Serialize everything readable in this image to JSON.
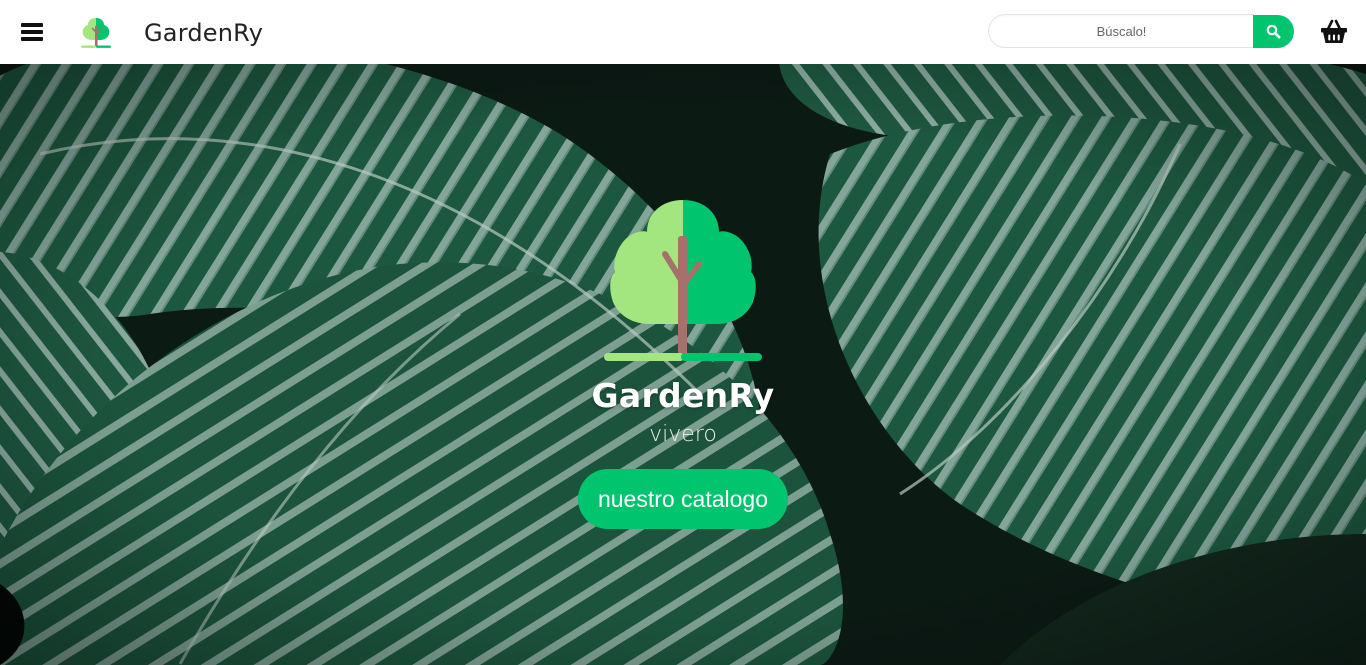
{
  "header": {
    "brand": "GardenRy",
    "search_placeholder": "Búscalo!"
  },
  "hero": {
    "title": "GardenRy",
    "subtitle": "vivero",
    "cta_label": "nuestro catalogo"
  },
  "icons": {
    "menu": "hamburger-menu-icon",
    "logo": "tree-logo-icon",
    "search": "magnifier-icon",
    "cart": "shopping-basket-icon"
  },
  "colors": {
    "accent": "#00c46e",
    "tree_light": "#a3e67f",
    "tree_dark": "#00c46e",
    "trunk": "#a5716a",
    "leaf_dark": "#1e5e44",
    "leaf_stripe": "#8fb3a8"
  }
}
